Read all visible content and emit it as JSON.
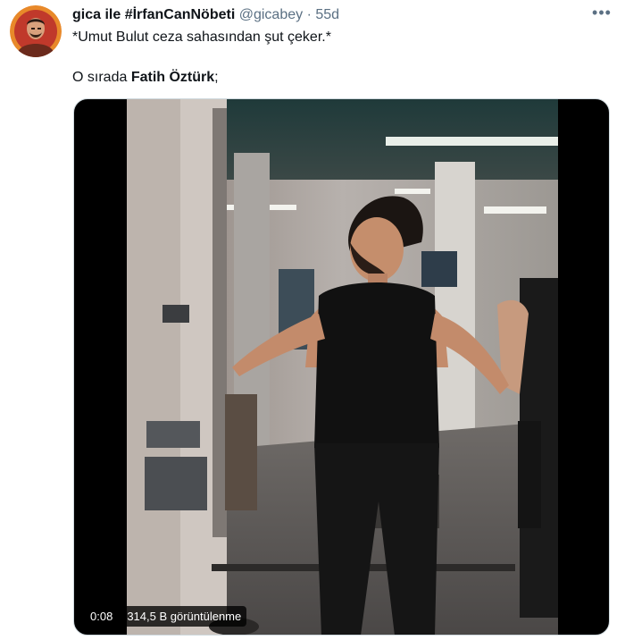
{
  "tweet": {
    "author_name": "gica ile #İrfanCanNöbeti",
    "handle": "@gicabey",
    "separator": "·",
    "time": "55d",
    "more_label": "•••",
    "line1": "*Umut Bulut ceza sahasından şut çeker.*",
    "line2_prefix": "O sırada ",
    "line2_bold": "Fatih Öztürk",
    "line2_suffix": ";"
  },
  "video": {
    "elapsed": "0:08",
    "views": "314,5 B görüntülenme"
  },
  "colors": {
    "secondary_text": "#5b7083",
    "primary_text": "#0f1419",
    "media_border": "#cfd9de"
  }
}
